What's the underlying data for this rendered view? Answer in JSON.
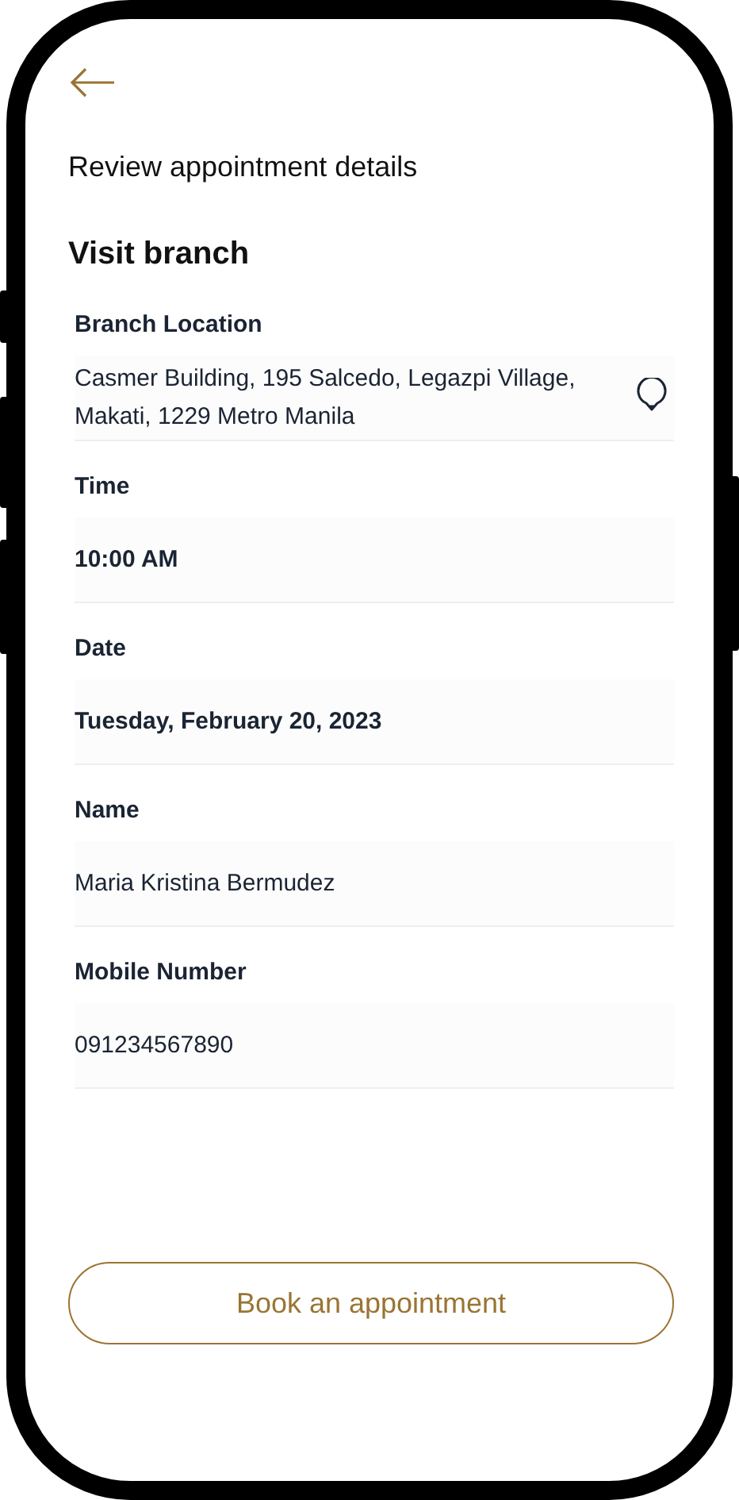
{
  "header": {
    "title": "Review appointment details"
  },
  "section": {
    "title": "Visit branch"
  },
  "fields": [
    {
      "kind": "location",
      "label": "Branch Location",
      "value": "Casmer Building, 195 Salcedo, Legazpi Village, Makati, 1229 Metro Manila"
    },
    {
      "kind": "bold",
      "label": "Time",
      "value": "10:00 AM"
    },
    {
      "kind": "bold",
      "label": "Date",
      "value": "Tuesday, February 20, 2023"
    },
    {
      "kind": "plain",
      "label": "Name",
      "value": "Maria Kristina Bermudez"
    },
    {
      "kind": "plain",
      "label": "Mobile Number",
      "value": "091234567890"
    }
  ],
  "button": {
    "label": "Book an appointment"
  }
}
